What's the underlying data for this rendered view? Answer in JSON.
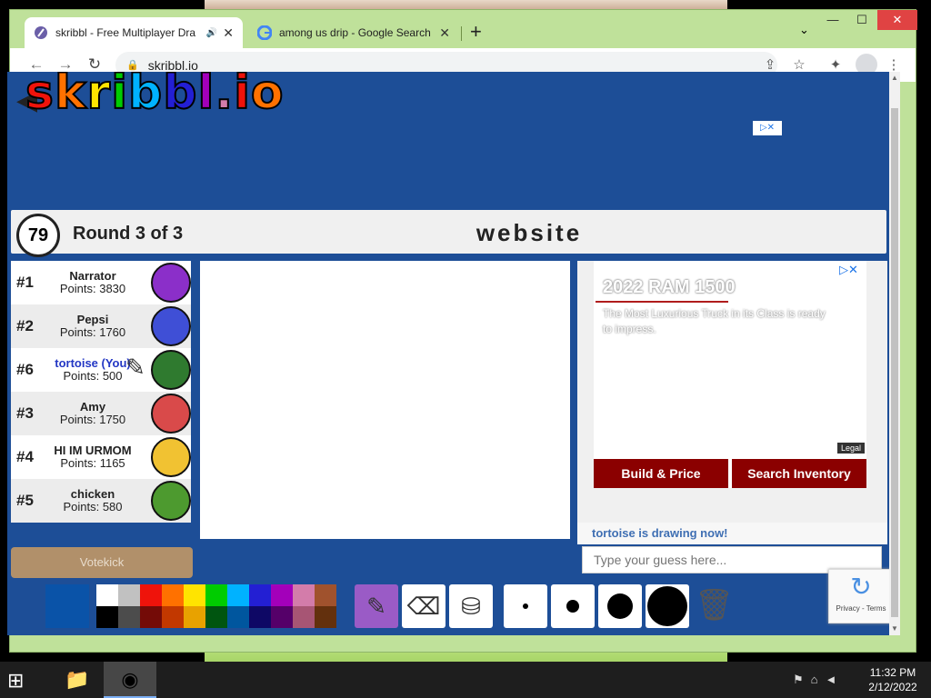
{
  "browser": {
    "tabs": [
      {
        "title": "skribbl - Free Multiplayer Dra",
        "active": true
      },
      {
        "title": "among us drip - Google Search",
        "active": false
      }
    ],
    "url": "skribbl.io",
    "window_controls": {
      "minimize": "—",
      "maximize": "☐",
      "close": "✕"
    }
  },
  "game": {
    "logo": "skribbl.io",
    "timer": "79",
    "round_text": "Round 3 of 3",
    "word": "website",
    "players": [
      {
        "rank": "#1",
        "name": "Narrator",
        "points": "Points: 3830",
        "color": "#8b2fc9",
        "you": false,
        "drawing": false
      },
      {
        "rank": "#2",
        "name": "Pepsi",
        "points": "Points: 1760",
        "color": "#3f4fd6",
        "you": false,
        "drawing": false
      },
      {
        "rank": "#6",
        "name": "tortoise (You)",
        "points": "Points: 500",
        "color": "#2f7a2f",
        "you": true,
        "drawing": true
      },
      {
        "rank": "#3",
        "name": "Amy",
        "points": "Points: 1750",
        "color": "#d94a4a",
        "you": false,
        "drawing": false
      },
      {
        "rank": "#4",
        "name": "HI IM URMOM",
        "points": "Points: 1165",
        "color": "#f1c232",
        "you": false,
        "drawing": false
      },
      {
        "rank": "#5",
        "name": "chicken",
        "points": "Points: 580",
        "color": "#4d9a2f",
        "you": false,
        "drawing": false
      }
    ],
    "votekick_label": "Votekick",
    "chat_status": "tortoise is drawing now!",
    "guess_placeholder": "Type your guess here...",
    "palette": {
      "current": "#0a53a8",
      "top_row": [
        "#ffffff",
        "#c1c1c1",
        "#ef130b",
        "#ff7100",
        "#ffe400",
        "#00cc00",
        "#00b2ff",
        "#231fd3",
        "#a300ba",
        "#d37caa",
        "#a0522d"
      ],
      "bottom_row": [
        "#000000",
        "#4c4c4c",
        "#740b07",
        "#c23800",
        "#e8a200",
        "#005510",
        "#00569e",
        "#0e0865",
        "#550069",
        "#a75574",
        "#63300d"
      ]
    },
    "tools": [
      "pencil-icon",
      "eraser-icon",
      "fill-bucket-icon"
    ],
    "brush_sizes": [
      "small",
      "medium",
      "large",
      "xlarge"
    ]
  },
  "ad": {
    "title": "2022 RAM 1500",
    "subtitle": "The Most Luxurious Truck in its Class is ready to impress.",
    "legal": "Legal",
    "buttons": [
      "Build & Price",
      "Search Inventory"
    ],
    "accent_color": "#8b0000"
  },
  "recaptcha": {
    "text": "Privacy - Terms"
  },
  "taskbar": {
    "time": "11:32 PM",
    "date": "2/12/2022"
  }
}
